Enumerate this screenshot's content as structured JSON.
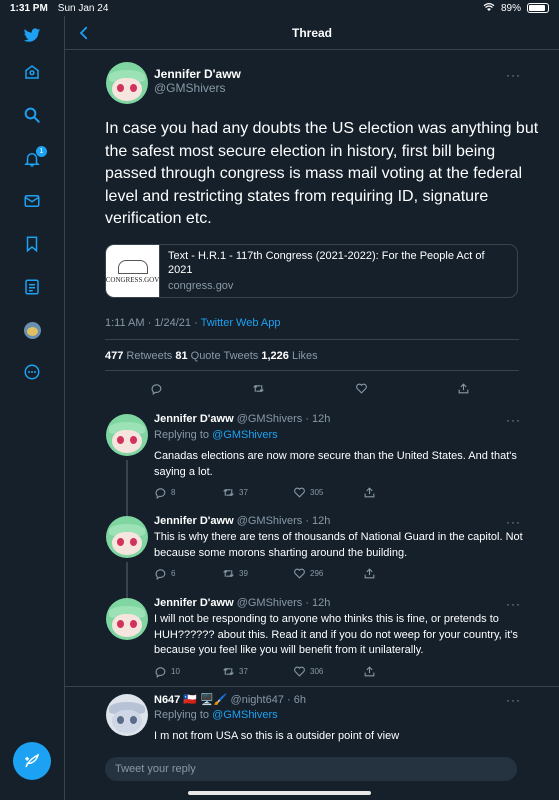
{
  "status_bar": {
    "time": "1:31 PM",
    "date": "Sun Jan 24",
    "battery": "89%",
    "battery_level": 0.89
  },
  "sidebar": {
    "items": [
      {
        "name": "twitter-logo-icon"
      },
      {
        "name": "home-icon"
      },
      {
        "name": "search-icon"
      },
      {
        "name": "notifications-icon",
        "badge": "1"
      },
      {
        "name": "messages-icon"
      },
      {
        "name": "bookmarks-icon"
      },
      {
        "name": "lists-icon"
      },
      {
        "name": "profile-icon"
      },
      {
        "name": "more-icon"
      }
    ],
    "accent": "#1da1f2"
  },
  "header": {
    "title": "Thread"
  },
  "main_tweet": {
    "name": "Jennifer D'aww",
    "handle": "@GMShivers",
    "more": "···",
    "text": "In case you had any doubts the US election was anything but the safest most secure election in history, first bill being passed through congress is mass mail voting at the federal level and restricting states from requiring ID, signature verification etc.",
    "card": {
      "thumb_text": "CONGRESS.GOV",
      "title": "Text - H.R.1 - 117th Congress (2021-2022): For the People Act of 2021",
      "domain": "congress.gov"
    },
    "timestamp": "1:11 AM · 1/24/21 · ",
    "via": "Twitter Web App",
    "retweets": "477",
    "retweets_label": " Retweets ",
    "quotes": "81",
    "quotes_label": " Quote Tweets ",
    "likes": "1,226",
    "likes_label": " Likes"
  },
  "replies": [
    {
      "name": "Jennifer D'aww",
      "handle": " @GMShivers · 12h",
      "replying_label": "Replying to ",
      "replying_to": "@GMShivers",
      "text": "Canadas elections are now more secure than the United States. And that's saying a lot.",
      "replies": "8",
      "retweets": "37",
      "likes": "305"
    },
    {
      "name": "Jennifer D'aww",
      "handle": " @GMShivers · 12h",
      "text": "This is why there are tens of thousands of National Guard in the capitol. Not because some morons sharting around the building.",
      "replies": "6",
      "retweets": "39",
      "likes": "296"
    },
    {
      "name": "Jennifer D'aww",
      "handle": " @GMShivers · 12h",
      "text": "I will not be responding to anyone who thinks this is fine, or pretends to HUH?????? about this. Read it and if you do not weep for your country, it's because you feel like you will benefit from it unilaterally.",
      "replies": "10",
      "retweets": "37",
      "likes": "306"
    },
    {
      "name": "N647 🇨🇱 🖥️🖌️",
      "handle": " @night647 · 6h",
      "replying_label": "Replying to ",
      "replying_to": "@GMShivers",
      "text": "I m not  from USA so this is a outsider point of view"
    }
  ],
  "reply_bar": {
    "placeholder": "Tweet your reply"
  }
}
